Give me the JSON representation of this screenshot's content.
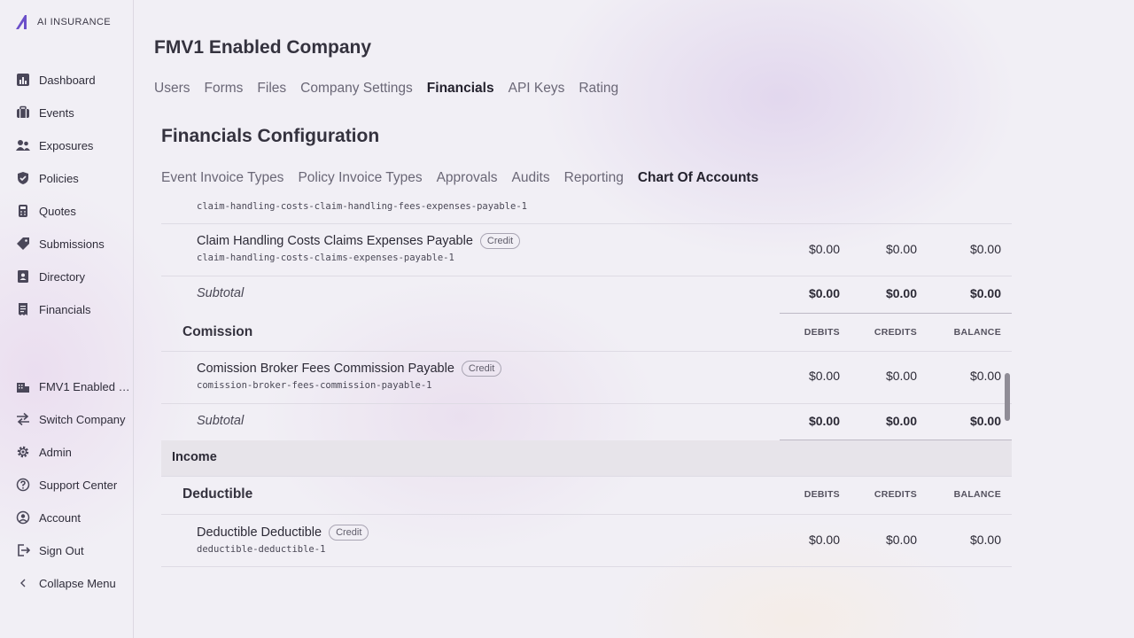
{
  "brand": {
    "logo_text": "AI INSURANCE",
    "accent": "#6b4fc9"
  },
  "sidebar": {
    "items": [
      {
        "label": "Dashboard",
        "icon": "chart-icon"
      },
      {
        "label": "Events",
        "icon": "briefcase-icon"
      },
      {
        "label": "Exposures",
        "icon": "users-icon"
      },
      {
        "label": "Policies",
        "icon": "shield-icon"
      },
      {
        "label": "Quotes",
        "icon": "calculator-icon"
      },
      {
        "label": "Submissions",
        "icon": "tag-icon"
      },
      {
        "label": "Directory",
        "icon": "address-book-icon"
      },
      {
        "label": "Financials",
        "icon": "receipt-icon"
      }
    ],
    "bottom_items": [
      {
        "label": "FMV1 Enabled …",
        "icon": "building-icon"
      },
      {
        "label": "Switch Company",
        "icon": "swap-icon"
      },
      {
        "label": "Admin",
        "icon": "gear-icon"
      },
      {
        "label": "Support Center",
        "icon": "help-icon"
      },
      {
        "label": "Account",
        "icon": "user-circle-icon"
      },
      {
        "label": "Sign Out",
        "icon": "sign-out-icon"
      },
      {
        "label": "Collapse Menu",
        "icon": "chevron-left-icon"
      }
    ]
  },
  "header": {
    "company_title": "FMV1 Enabled Company",
    "tabs": [
      "Users",
      "Forms",
      "Files",
      "Company Settings",
      "Financials",
      "API Keys",
      "Rating"
    ],
    "active_tab": "Financials"
  },
  "financials": {
    "title": "Financials Configuration",
    "subtabs": [
      "Event Invoice Types",
      "Policy Invoice Types",
      "Approvals",
      "Audits",
      "Reporting",
      "Chart Of Accounts"
    ],
    "active_subtab": "Chart Of Accounts"
  },
  "table": {
    "col_headers": {
      "debits": "DEBITS",
      "credits": "CREDITS",
      "balance": "BALANCE"
    },
    "partial_code": "claim-handling-costs-claim-handling-fees-expenses-payable-1",
    "rows": {
      "claim_exp": {
        "name": "Claim Handling Costs Claims Expenses Payable",
        "badge": "Credit",
        "code": "claim-handling-costs-claims-expenses-payable-1",
        "debits": "$0.00",
        "credits": "$0.00",
        "balance": "$0.00"
      },
      "subtotal1": {
        "label": "Subtotal",
        "debits": "$0.00",
        "credits": "$0.00",
        "balance": "$0.00"
      },
      "comission_group": {
        "label": "Comission"
      },
      "comission_broker": {
        "name": "Comission Broker Fees Commission Payable",
        "badge": "Credit",
        "code": "comission-broker-fees-commission-payable-1",
        "debits": "$0.00",
        "credits": "$0.00",
        "balance": "$0.00"
      },
      "subtotal2": {
        "label": "Subtotal",
        "debits": "$0.00",
        "credits": "$0.00",
        "balance": "$0.00"
      },
      "income_category": {
        "label": "Income"
      },
      "deductible_group": {
        "label": "Deductible"
      },
      "deductible": {
        "name": "Deductible Deductible",
        "badge": "Credit",
        "code": "deductible-deductible-1",
        "debits": "$0.00",
        "credits": "$0.00",
        "balance": "$0.00"
      }
    }
  }
}
